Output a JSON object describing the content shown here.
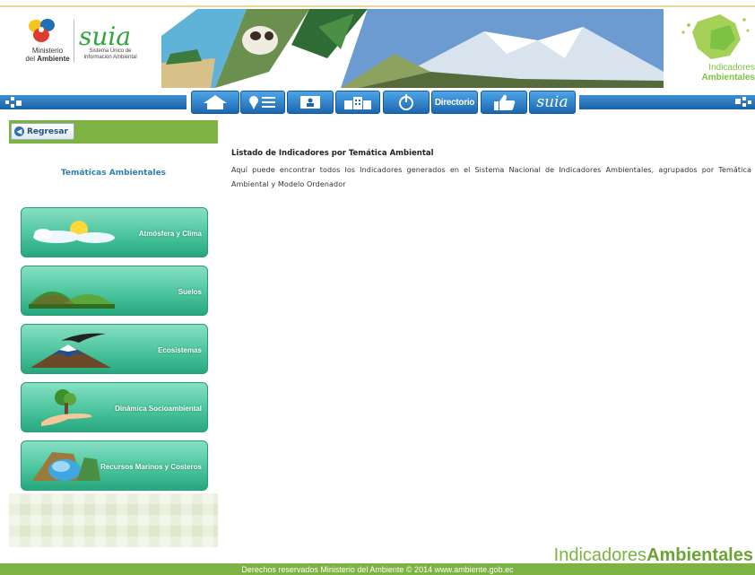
{
  "header": {
    "ministerio_line1": "Ministerio",
    "ministerio_line2_prefix": "del",
    "ministerio_line2_bold": "Ambiente",
    "suia_logo_text": "suia",
    "suia_sub_line1": "Sistema Único de",
    "suia_sub_line2": "Información Ambiental",
    "indicadores_logo_line1": "Indicadores",
    "indicadores_logo_line2": "Ambientales"
  },
  "navbar": {
    "items": [
      {
        "icon": "home-icon",
        "label": ""
      },
      {
        "icon": "pin-list-icon",
        "label": ""
      },
      {
        "icon": "id-card-icon",
        "label": ""
      },
      {
        "icon": "buildings-icon",
        "label": ""
      },
      {
        "icon": "power-icon",
        "label": ""
      },
      {
        "icon": "",
        "label": "Directorio"
      },
      {
        "icon": "thumbs-up-icon",
        "label": ""
      },
      {
        "icon": "suia-logo-icon",
        "label": "suia"
      }
    ]
  },
  "sidebar": {
    "back_label": "Regresar",
    "title": "Temáticas Ambientales",
    "themes": [
      {
        "label": "Atmósfera y Clima",
        "icon": "sun-clouds-icon"
      },
      {
        "label": "Suelos",
        "icon": "hills-icon"
      },
      {
        "label": "Ecosistemas",
        "icon": "condor-volcano-icon"
      },
      {
        "label": "Dinámica Socioambiental",
        "icon": "tree-hand-icon"
      },
      {
        "label": "Recursos Marinos y Costeros",
        "icon": "coast-icon"
      }
    ]
  },
  "main": {
    "title": "Listado de Indicadores por Temática Ambiental",
    "description": "Aquí puede encontrar todos los Indicadores generados en el Sistema Nacional de Indicadores Ambientales, agrupados por Temática Ambiental y Modelo Ordenador"
  },
  "footer": {
    "brand_light": "Indicadores",
    "brand_bold": "Ambientales",
    "copyright": "Derechos reservados Ministerio del Ambiente © 2014 www.ambiente.gob.ec"
  },
  "colors": {
    "nav_blue": "#1c66b0",
    "accent_green": "#7cb342",
    "theme_teal": "#4cc59e",
    "title_blue": "#2f7fae"
  }
}
